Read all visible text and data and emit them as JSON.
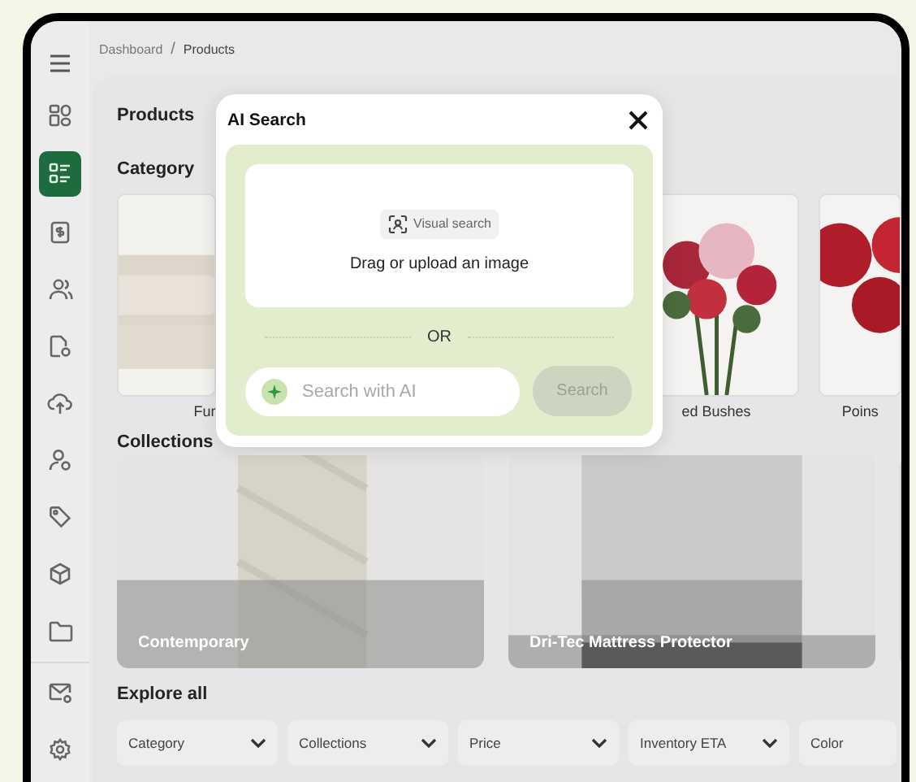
{
  "breadcrumb": {
    "items": [
      "Dashboard",
      "Products"
    ],
    "separator": "/"
  },
  "sidebar": {
    "items": [
      {
        "kind": "menu",
        "selected": false
      },
      {
        "kind": "grid",
        "selected": false
      },
      {
        "kind": "list",
        "selected": true
      },
      {
        "kind": "invoice",
        "selected": false
      },
      {
        "kind": "users",
        "selected": false
      },
      {
        "kind": "filecog",
        "selected": false
      },
      {
        "kind": "upload",
        "selected": false
      },
      {
        "kind": "usercog",
        "selected": false
      },
      {
        "kind": "tag",
        "selected": false
      },
      {
        "kind": "cube",
        "selected": false
      },
      {
        "kind": "folder",
        "selected": false
      },
      {
        "kind": "mail",
        "selected": false
      },
      {
        "kind": "settings",
        "selected": false
      }
    ]
  },
  "page_title": "Products",
  "category": {
    "heading": "Category",
    "cards": [
      {
        "label": "Fur"
      },
      {
        "label": "ed Bushes"
      },
      {
        "label": "Poins"
      }
    ]
  },
  "collections": {
    "heading": "Collections",
    "cards": [
      {
        "label": "Contemporary"
      },
      {
        "label": "Dri-Tec Mattress Protector"
      }
    ]
  },
  "explore": {
    "heading": "Explore all",
    "filters": [
      "Category",
      "Collections",
      "Price",
      "Inventory ETA",
      "Color"
    ]
  },
  "modal": {
    "title": "AI Search",
    "visual_search": "Visual search",
    "drop_text": "Drag or upload an image",
    "divider": "OR",
    "search": {
      "placeholder": "Search with AI"
    },
    "button": {
      "label": "Search",
      "disabled": true
    }
  }
}
